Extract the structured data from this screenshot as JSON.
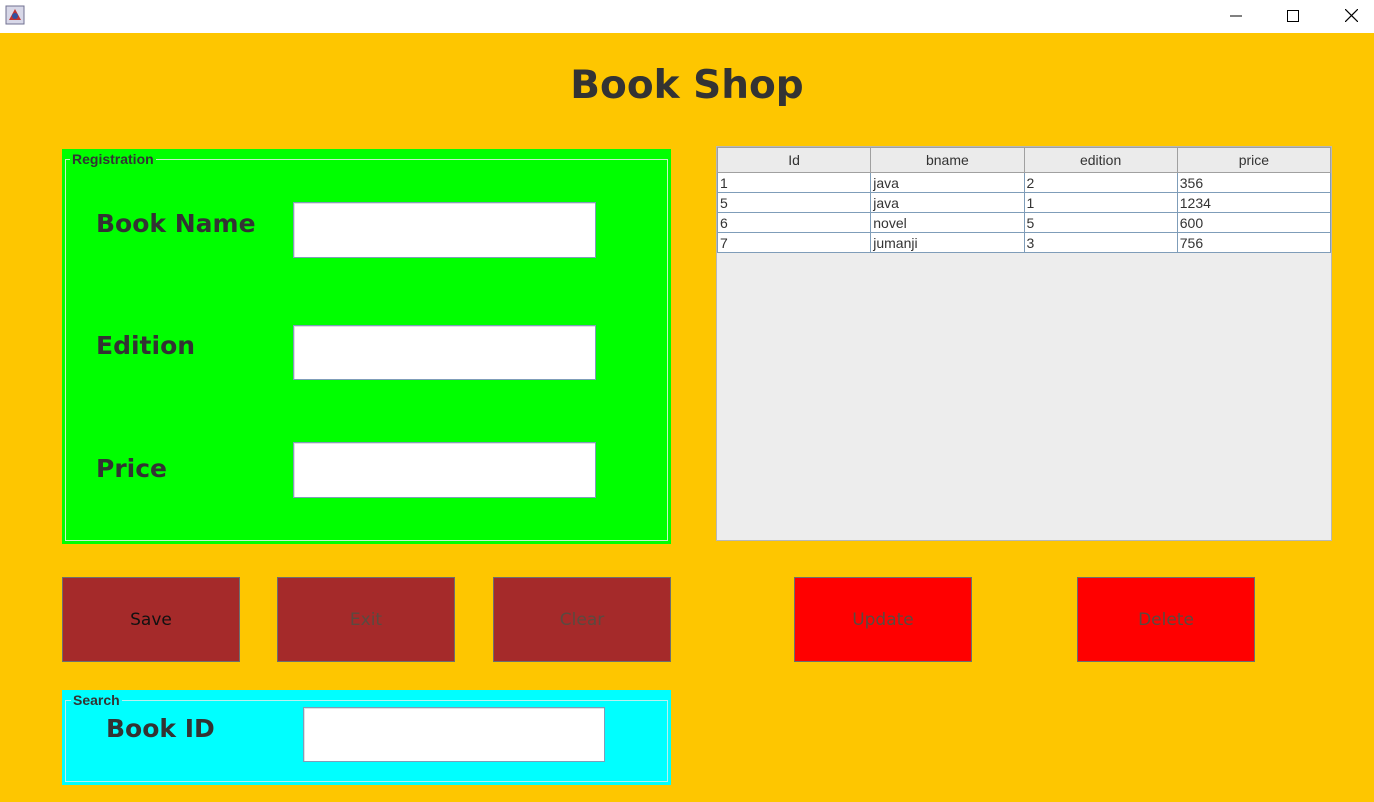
{
  "window": {
    "controls": [
      "minimize-icon",
      "maximize-icon",
      "close-icon"
    ]
  },
  "header": {
    "title": "Book Shop"
  },
  "registration": {
    "legend": "Registration",
    "fields": [
      {
        "label": "Book Name",
        "value": ""
      },
      {
        "label": "Edition",
        "value": ""
      },
      {
        "label": "Price",
        "value": ""
      }
    ]
  },
  "table": {
    "columns": [
      "Id",
      "bname",
      "edition",
      "price"
    ],
    "rows": [
      [
        "1",
        "java",
        "2",
        "356"
      ],
      [
        "5",
        "java",
        "1",
        "1234"
      ],
      [
        "6",
        "novel",
        "5",
        "600"
      ],
      [
        "7",
        "jumanji",
        "3",
        "756"
      ]
    ]
  },
  "buttons": {
    "save": "Save",
    "exit": "Exit",
    "clear": "Clear",
    "update": "Update",
    "delete": "Delete"
  },
  "search": {
    "legend": "Search",
    "label": "Book ID",
    "value": ""
  },
  "colors": {
    "background": "#fec600",
    "registration_panel": "#00ff00",
    "search_panel": "#00ffff",
    "button_brown": "#a52a2a",
    "button_red": "#ff0000"
  }
}
